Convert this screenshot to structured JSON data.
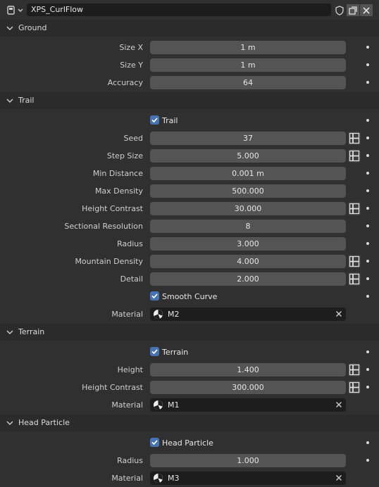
{
  "header": {
    "type_icon": "datablock-icon",
    "name": "XPS_CurlFlow",
    "buttons": [
      "shield-icon",
      "duplicate-icon",
      "close-icon"
    ]
  },
  "panels": {
    "ground": {
      "title": "Ground",
      "size_x": {
        "label": "Size X",
        "value": "1 m"
      },
      "size_y": {
        "label": "Size Y",
        "value": "1 m"
      },
      "accuracy": {
        "label": "Accuracy",
        "value": "64"
      }
    },
    "trail": {
      "title": "Trail",
      "enabled": {
        "label": "Trail",
        "checked": true
      },
      "seed": {
        "label": "Seed",
        "value": "37"
      },
      "step_size": {
        "label": "Step Size",
        "value": "5.000"
      },
      "min_distance": {
        "label": "Min Distance",
        "value": "0.001 m"
      },
      "max_density": {
        "label": "Max Density",
        "value": "500.000"
      },
      "height_contrast": {
        "label": "Height Contrast",
        "value": "30.000"
      },
      "sectional_resolution": {
        "label": "Sectional Resolution",
        "value": "8"
      },
      "radius": {
        "label": "Radius",
        "value": "3.000"
      },
      "mountain_density": {
        "label": "Mountain Density",
        "value": "4.000"
      },
      "detail": {
        "label": "Detail",
        "value": "2.000"
      },
      "smooth_curve": {
        "label": "Smooth Curve",
        "checked": true
      },
      "material": {
        "label": "Material",
        "value": "M2"
      }
    },
    "terrain": {
      "title": "Terrain",
      "enabled": {
        "label": "Terrain",
        "checked": true
      },
      "height": {
        "label": "Height",
        "value": "1.400"
      },
      "height_contrast": {
        "label": "Height Contrast",
        "value": "300.000"
      },
      "material": {
        "label": "Material",
        "value": "M1"
      }
    },
    "head_particle": {
      "title": "Head Particle",
      "enabled": {
        "label": "Head Particle",
        "checked": true
      },
      "radius": {
        "label": "Radius",
        "value": "1.000"
      },
      "material": {
        "label": "Material",
        "value": "M3"
      }
    }
  },
  "colors": {
    "background": "#303030",
    "panel_header": "#2b2b2b",
    "field": "#545454",
    "dark_field": "#1d1d1d",
    "checkbox": "#4772b3"
  }
}
